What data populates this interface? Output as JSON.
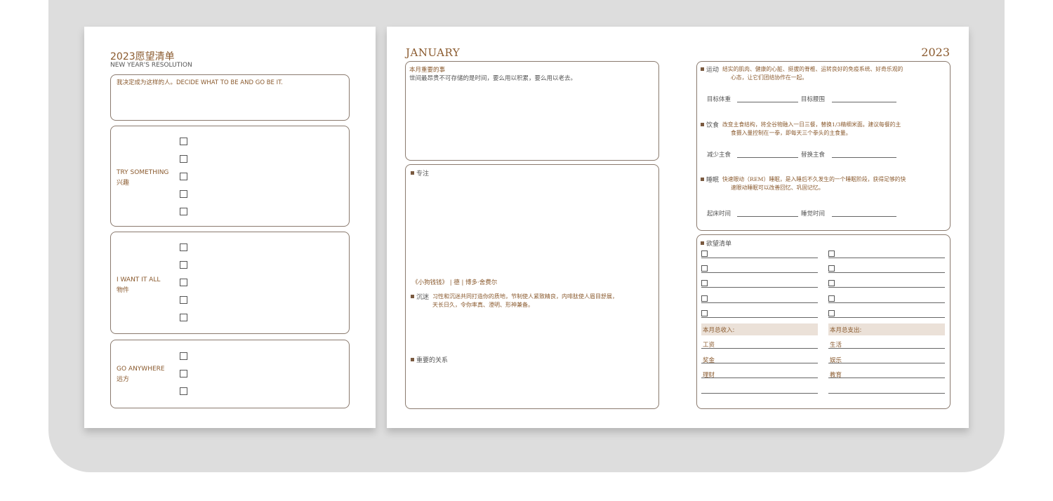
{
  "left_page": {
    "title": "2023愿望清单",
    "subtitle": "NEW YEAR'S RESOLUTION",
    "resolution_text": "我决定成为这样的人。DECIDE WHAT TO BE AND GO BE IT.",
    "sections": [
      {
        "label_en": "TRY SOMETHING",
        "label_cn": "兴趣",
        "checkbox_count": 5
      },
      {
        "label_en": "I WANT IT ALL",
        "label_cn": "物件",
        "checkbox_count": 5
      },
      {
        "label_en": "GO ANYWHERE",
        "label_cn": "远方",
        "checkbox_count": 3
      }
    ]
  },
  "right_page": {
    "month": "JANUARY",
    "year": "2023",
    "important": {
      "title": "本月重要的事",
      "text": "世间最昂贵不可存储的是时间，要么用以积累，要么用以老去。"
    },
    "focus": {
      "title": "专注",
      "quote_source": "《小狗钱钱》 | 德 | 博多·舍费尔",
      "immersion_label": "沉迷",
      "immersion_text_1": "习性和沉迷共同打造你的质地，节制使人紧致精良，内啡肽使人眉目舒展，",
      "immersion_text_2": "天长日久，令你率真、澄明、形神兼备。",
      "relations_title": "重要的关系"
    },
    "health": {
      "exercise_label": "运动",
      "exercise_text_1": "结实的肌肉、健康的心脏、挺拔的脊椎、运转良好的免疫系统、好奇乐观的",
      "exercise_text_2": "心态，让它们团结协作在一起。",
      "target_weight": "目标体重",
      "target_waist": "目标腰围",
      "diet_label": "饮食",
      "diet_text_1": "改变主食结构，将全谷物融入一日三餐，替换1/3精细米面。建议每餐的主",
      "diet_text_2": "食摄入量控制在一拳，即每天三个拳头的主食量。",
      "reduce_staple": "减少主食",
      "replace_staple": "替换主食",
      "sleep_label": "睡眠",
      "sleep_text_1": "快速眼动（REM）睡眠，是入睡后不久发生的一个睡眠阶段，获得足够的快",
      "sleep_text_2": "速眼动睡眠可以改善回忆、巩固记忆。",
      "wake_time": "起床时间",
      "sleep_time": "睡觉时间"
    },
    "wishlist": {
      "title": "欲望清单",
      "income_title": "本月总收入:",
      "expense_title": "本月总支出:",
      "income_items": [
        "工资",
        "奖金",
        "理财"
      ],
      "expense_items": [
        "生活",
        "娱乐",
        "教育"
      ]
    }
  },
  "colors": {
    "accent": "#8a5a2e",
    "shade": "#ebe1d8",
    "backdrop": "#dddddd"
  }
}
